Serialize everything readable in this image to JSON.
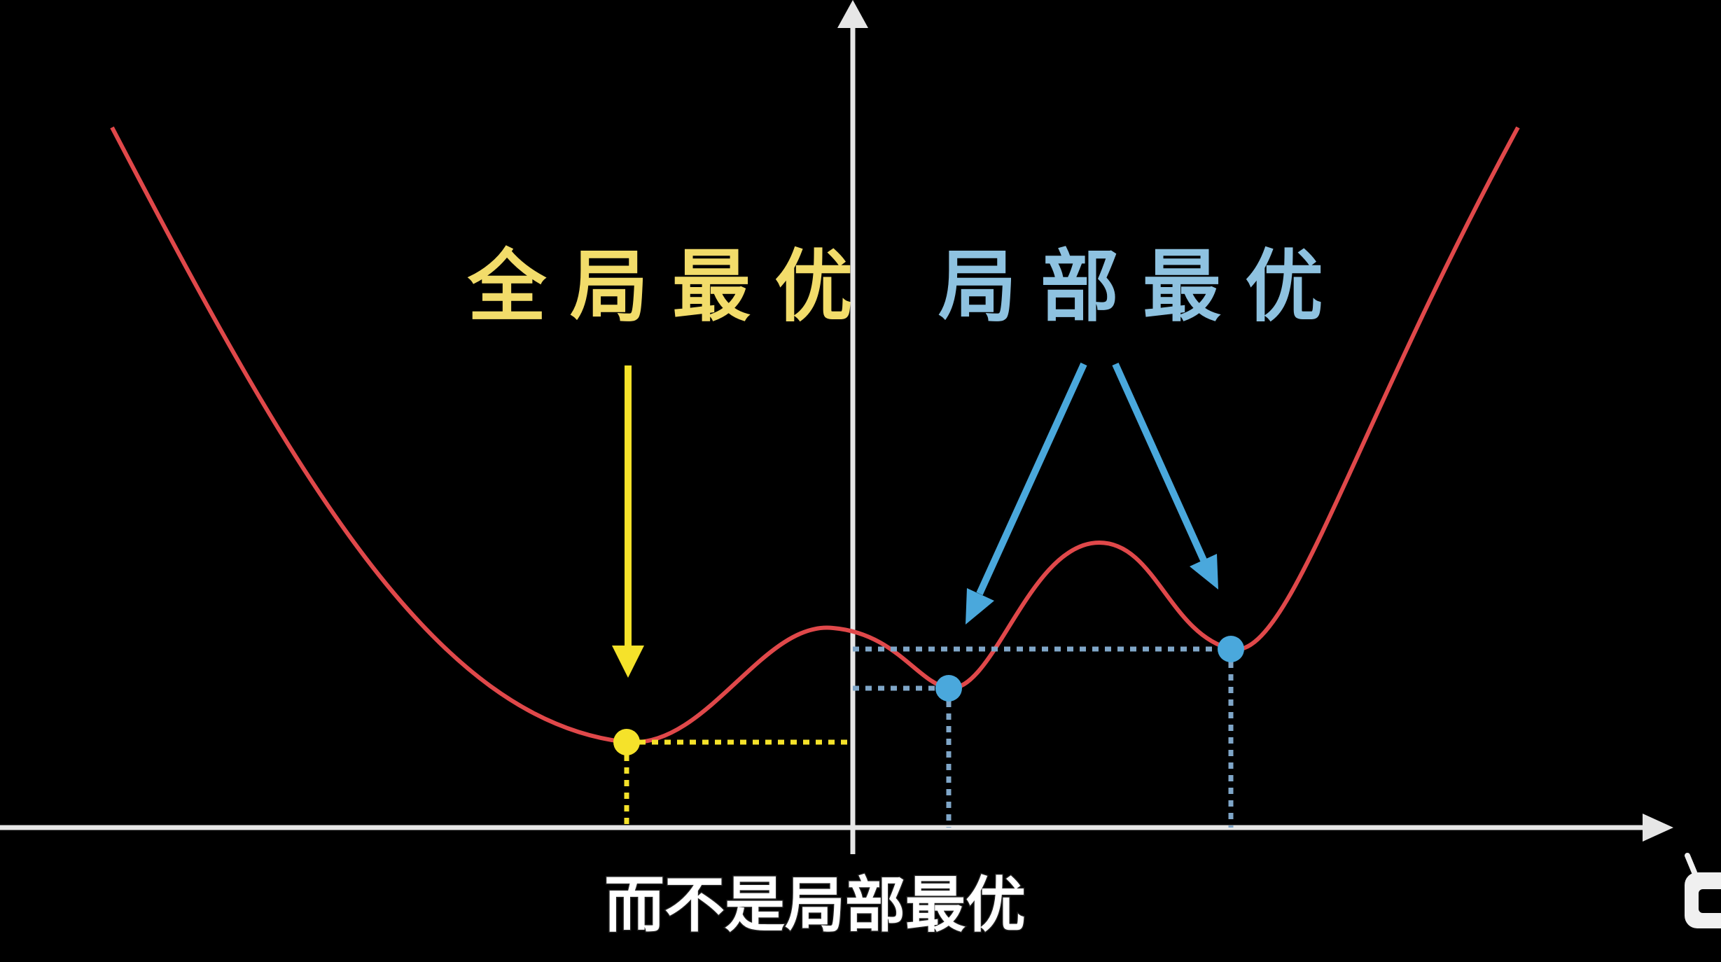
{
  "diagram": {
    "global_label": "全局最优",
    "local_label": "局部最优",
    "subtitle": "而不是局部最优"
  },
  "colors": {
    "background": "#000000",
    "axis": "#e6e6e6",
    "curve": "#e0484a",
    "global": "#f5e22a",
    "global_label": "#f2dc6a",
    "local": "#4aa8dc",
    "local_label": "#8ec2e0",
    "subtitle": "#ffffff"
  },
  "icons": {
    "corner_logo": "tv-logo-icon"
  }
}
